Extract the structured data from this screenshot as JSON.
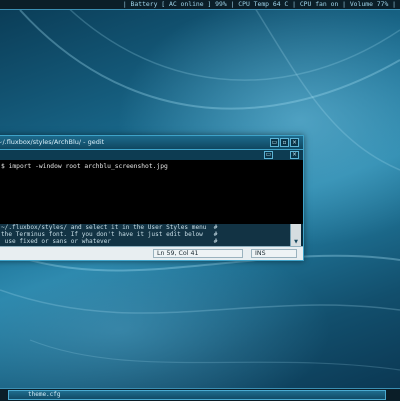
{
  "topbar": {
    "status": "| Battery [ AC online ] 99% | CPU Temp 64 C | CPU fan on | Volume 77% |"
  },
  "window": {
    "title": "~/.fluxbox/styles/ArchBlu/ - gedit",
    "titlebar_buttons": [
      "▭",
      "▫",
      "×"
    ],
    "menubar_buttons": [
      "▭",
      "×"
    ],
    "terminal_line": "$ import -window root archblu_screenshot.jpg",
    "editor_lines": [
      "~/.fluxbox/styles/ and select it in the User Styles menu  #",
      "the Terminus font. If you don't have it just edit below   #",
      " use fixed or sans or whatever                            #"
    ],
    "status": {
      "position": "Ln 59, Col 41",
      "mode": "INS"
    }
  },
  "taskbar": {
    "item_label": "theme.cfg"
  },
  "colors": {
    "accent": "#3ea3c9",
    "desktop": "#1b6f93"
  }
}
